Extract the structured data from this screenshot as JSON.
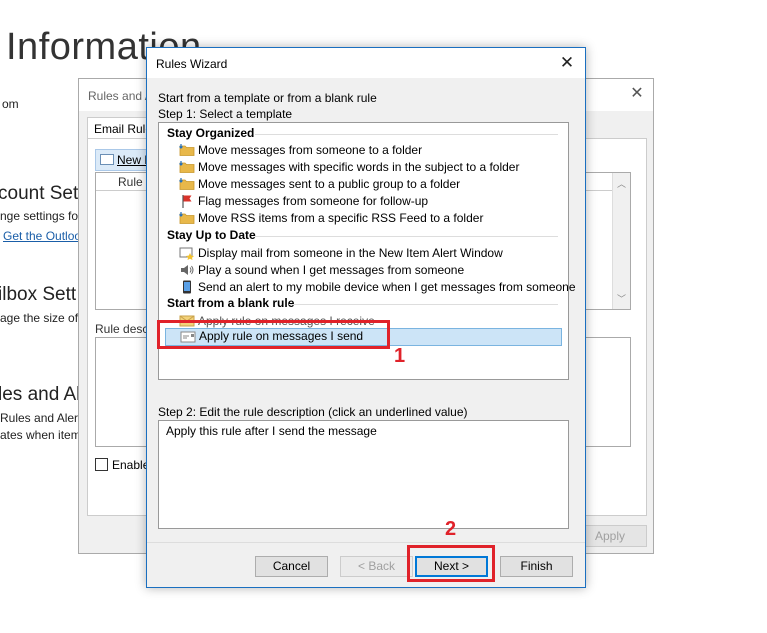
{
  "backstage": {
    "title": "Information",
    "account_fragment": "om",
    "account_settings_heading": "count Sett",
    "account_settings_text": "nge settings fo",
    "get_outlook_link": "Get the Outloo",
    "mailbox_heading": "ilbox Sett",
    "mailbox_text": "age the size of",
    "rules_heading": "les and Al",
    "rules_text_1": "Rules and Alert",
    "rules_text_2": "ates when item"
  },
  "rules_alerts": {
    "title": "Rules and A",
    "tab_label": "Email Rule",
    "new_rule_label": "New R",
    "list_header": "Rule (",
    "description_label": "Rule desc",
    "enable_label": "Enable",
    "apply_label": "Apply"
  },
  "wizard": {
    "title": "Rules Wizard",
    "intro": "Start from a template or from a blank rule",
    "step1": "Step 1: Select a template",
    "groups": [
      {
        "name": "Stay Organized",
        "items": [
          {
            "label": "Move messages from someone to a folder",
            "icon": "folder-icon"
          },
          {
            "label": "Move messages with specific words in the subject to a folder",
            "icon": "folder-icon"
          },
          {
            "label": "Move messages sent to a public group to a folder",
            "icon": "folder-icon"
          },
          {
            "label": "Flag messages from someone for follow-up",
            "icon": "flag-icon"
          },
          {
            "label": "Move RSS items from a specific RSS Feed to a folder",
            "icon": "folder-icon"
          }
        ]
      },
      {
        "name": "Stay Up to Date",
        "items": [
          {
            "label": "Display mail from someone in the New Item Alert Window",
            "icon": "alert-window-icon"
          },
          {
            "label": "Play a sound when I get messages from someone",
            "icon": "speaker-icon"
          },
          {
            "label": "Send an alert to my mobile device when I get messages from someone",
            "icon": "mobile-device-icon"
          }
        ]
      },
      {
        "name": "Start from a blank rule",
        "items": [
          {
            "label": "Apply rule on messages I receive",
            "icon": "envelope-icon"
          },
          {
            "label": "Apply rule on messages I send",
            "icon": "envelope-send-icon",
            "selected": true
          }
        ]
      }
    ],
    "step2": "Step 2: Edit the rule description (click an underlined value)",
    "description": "Apply this rule after I send the message",
    "buttons": {
      "cancel": "Cancel",
      "back": "< Back",
      "next": "Next >",
      "finish": "Finish"
    }
  },
  "annotations": {
    "marker_1": "1",
    "marker_2": "2",
    "color": "#e0222a"
  }
}
